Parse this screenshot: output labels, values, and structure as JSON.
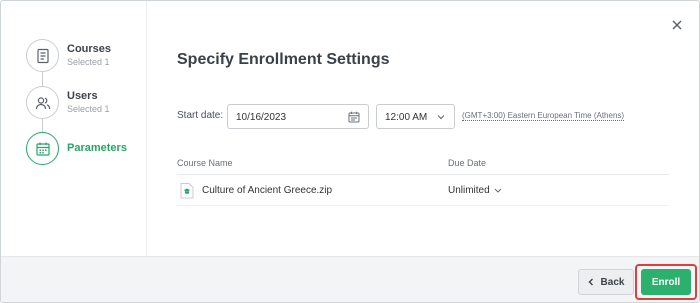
{
  "steps": [
    {
      "title": "Courses",
      "subtitle": "Selected 1",
      "icon": "document-icon"
    },
    {
      "title": "Users",
      "subtitle": "Selected 1",
      "icon": "users-icon"
    },
    {
      "title": "Parameters",
      "subtitle": "",
      "icon": "calendar-icon"
    }
  ],
  "main": {
    "heading": "Specify Enrollment Settings",
    "start_date_label": "Start date:",
    "start_date_value": "10/16/2023",
    "start_time_value": "12:00 AM",
    "timezone": "(GMT+3:00) Eastern European Time (Athens)"
  },
  "table": {
    "columns": [
      "Course Name",
      "Due Date"
    ],
    "rows": [
      {
        "course": "Culture of Ancient Greece.zip",
        "due": "Unlimited",
        "icon": "zip-file-icon"
      }
    ]
  },
  "footer": {
    "back_label": "Back",
    "enroll_label": "Enroll"
  },
  "colors": {
    "accent": "#27a566",
    "enroll": "#2bb06d",
    "highlight": "#d9403e"
  }
}
